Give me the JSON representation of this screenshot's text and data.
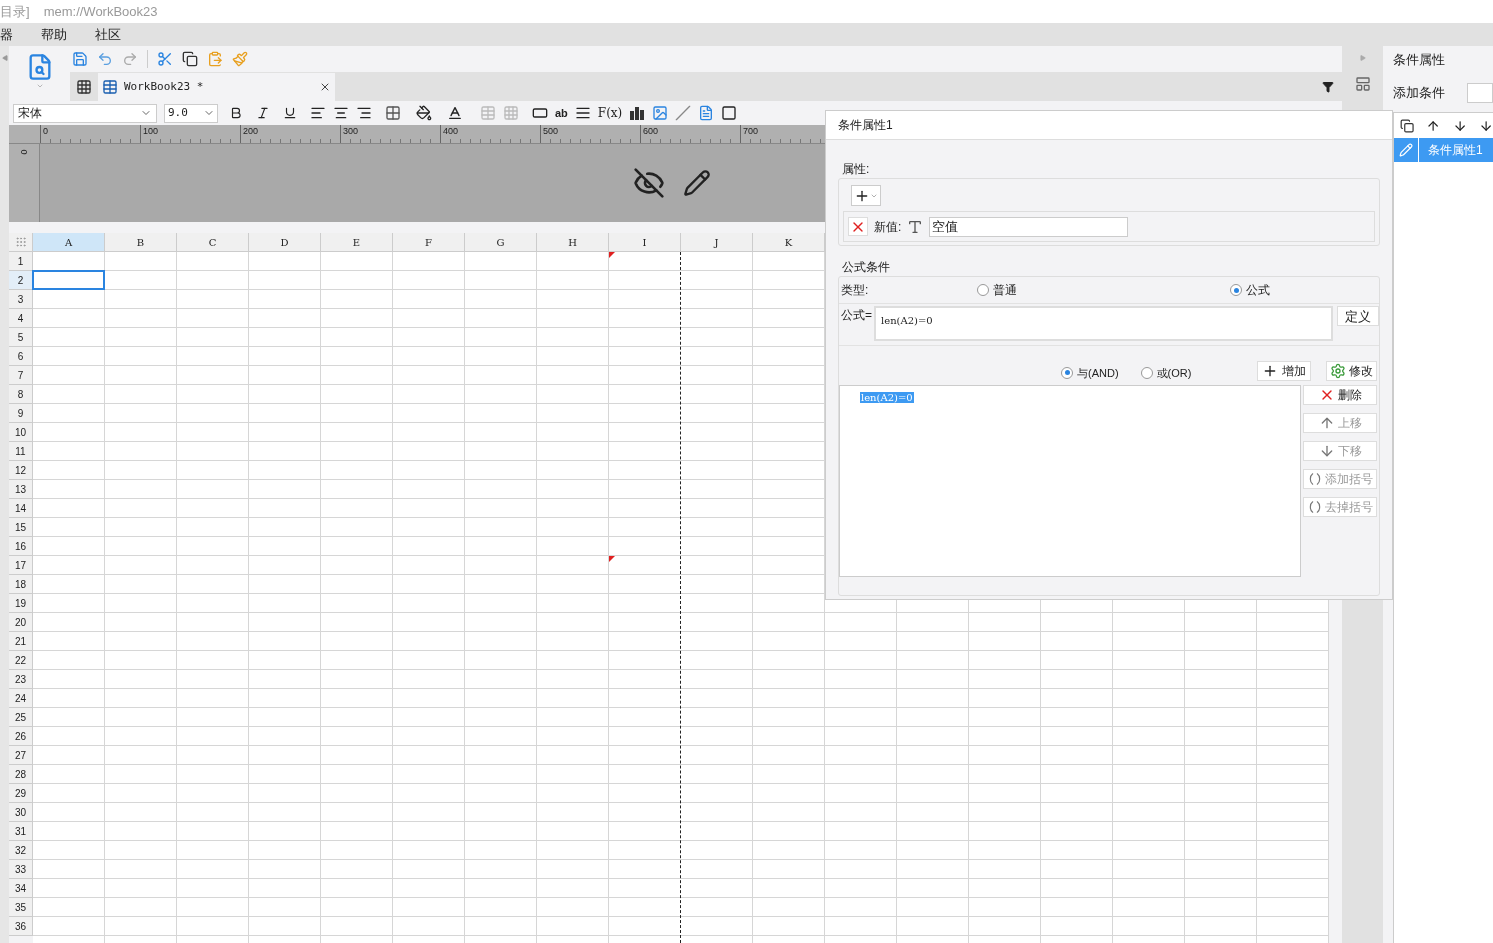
{
  "address_bar": {
    "label": "目录]",
    "path": "mem://WorkBook23"
  },
  "menu": [
    "器",
    "帮助",
    "社区"
  ],
  "tabs": [
    {
      "label": "WorkBook23 *",
      "selected": true
    }
  ],
  "format_bar": {
    "font": "宋体",
    "size": "9.0",
    "text_tools": [
      "ab",
      "F(x)"
    ]
  },
  "ruler": {
    "ticks": [
      "0",
      "100",
      "200",
      "300",
      "400",
      "500",
      "600",
      "700"
    ],
    "vertical": "0"
  },
  "sheet": {
    "columns": [
      {
        "label": "A",
        "selected": true,
        "marked": false,
        "page_break": false
      },
      {
        "label": "B",
        "selected": false,
        "marked": false,
        "page_break": false
      },
      {
        "label": "C",
        "selected": false,
        "marked": false,
        "page_break": false
      },
      {
        "label": "D",
        "selected": false,
        "marked": false,
        "page_break": false
      },
      {
        "label": "E",
        "selected": false,
        "marked": false,
        "page_break": false
      },
      {
        "label": "F",
        "selected": false,
        "marked": false,
        "page_break": false
      },
      {
        "label": "G",
        "selected": false,
        "marked": false,
        "page_break": false
      },
      {
        "label": "H",
        "selected": false,
        "marked": false,
        "page_break": false
      },
      {
        "label": "I",
        "selected": false,
        "marked": true,
        "page_break": true
      },
      {
        "label": "J",
        "selected": false,
        "marked": false,
        "page_break": false
      },
      {
        "label": "K",
        "selected": false,
        "marked": false,
        "page_break": false
      }
    ],
    "rows": [
      {
        "label": "1",
        "selected": false,
        "marked": true
      },
      {
        "label": "2",
        "selected": true,
        "marked": false
      },
      {
        "label": "3",
        "selected": false,
        "marked": false
      },
      {
        "label": "4",
        "selected": false,
        "marked": false
      },
      {
        "label": "5",
        "selected": false,
        "marked": false
      },
      {
        "label": "6",
        "selected": false,
        "marked": false
      },
      {
        "label": "7",
        "selected": false,
        "marked": false
      },
      {
        "label": "8",
        "selected": false,
        "marked": false
      },
      {
        "label": "9",
        "selected": false,
        "marked": false
      },
      {
        "label": "10",
        "selected": false,
        "marked": false
      },
      {
        "label": "11",
        "selected": false,
        "marked": false
      },
      {
        "label": "12",
        "selected": false,
        "marked": false
      },
      {
        "label": "13",
        "selected": false,
        "marked": false
      },
      {
        "label": "14",
        "selected": false,
        "marked": false
      },
      {
        "label": "15",
        "selected": false,
        "marked": false
      },
      {
        "label": "16",
        "selected": false,
        "marked": false
      },
      {
        "label": "17",
        "selected": false,
        "marked": true
      },
      {
        "label": "18",
        "selected": false,
        "marked": false
      },
      {
        "label": "19",
        "selected": false,
        "marked": false
      },
      {
        "label": "20",
        "selected": false,
        "marked": false
      },
      {
        "label": "21",
        "selected": false,
        "marked": false
      },
      {
        "label": "22",
        "selected": false,
        "marked": false
      },
      {
        "label": "23",
        "selected": false,
        "marked": false
      },
      {
        "label": "24",
        "selected": false,
        "marked": false
      },
      {
        "label": "25",
        "selected": false,
        "marked": false
      },
      {
        "label": "26",
        "selected": false,
        "marked": false
      },
      {
        "label": "27",
        "selected": false,
        "marked": false
      },
      {
        "label": "28",
        "selected": false,
        "marked": false
      },
      {
        "label": "29",
        "selected": false,
        "marked": false
      },
      {
        "label": "30",
        "selected": false,
        "marked": false
      },
      {
        "label": "31",
        "selected": false,
        "marked": false
      },
      {
        "label": "32",
        "selected": false,
        "marked": false
      },
      {
        "label": "33",
        "selected": false,
        "marked": false
      },
      {
        "label": "34",
        "selected": false,
        "marked": false
      },
      {
        "label": "35",
        "selected": false,
        "marked": false
      },
      {
        "label": "36",
        "selected": false,
        "marked": false
      }
    ]
  },
  "dialog": {
    "title": "条件属性1",
    "properties": {
      "legend": "属性:",
      "items": [
        {
          "label": "新值:",
          "value": "空值"
        }
      ]
    },
    "formula_condition": {
      "legend": "公式条件",
      "type_label": "类型:",
      "types": [
        {
          "label": "普通",
          "selected": false
        },
        {
          "label": "公式",
          "selected": true
        }
      ],
      "formula_label": "公式=",
      "formula": "len(A2)=0",
      "define_button": "定义",
      "joins": [
        {
          "label": "与(AND)",
          "selected": true
        },
        {
          "label": "或(OR)",
          "selected": false
        }
      ],
      "add_button": "增加",
      "edit_button": "修改",
      "conditions": [
        {
          "label": "len(A2)=0",
          "selected": true
        }
      ],
      "actions": [
        {
          "label": "删除",
          "kind": "delete",
          "disabled": false
        },
        {
          "label": "上移",
          "kind": "up",
          "disabled": true
        },
        {
          "label": "下移",
          "kind": "down",
          "disabled": true
        },
        {
          "label": "添加括号",
          "kind": "add_brackets",
          "disabled": true
        },
        {
          "label": "去掉括号",
          "kind": "remove_brackets",
          "disabled": true
        }
      ]
    }
  },
  "side_panel": {
    "title": "条件属性",
    "add_label": "添加条件",
    "items": [
      {
        "label": "条件属性1",
        "selected": true
      }
    ]
  }
}
